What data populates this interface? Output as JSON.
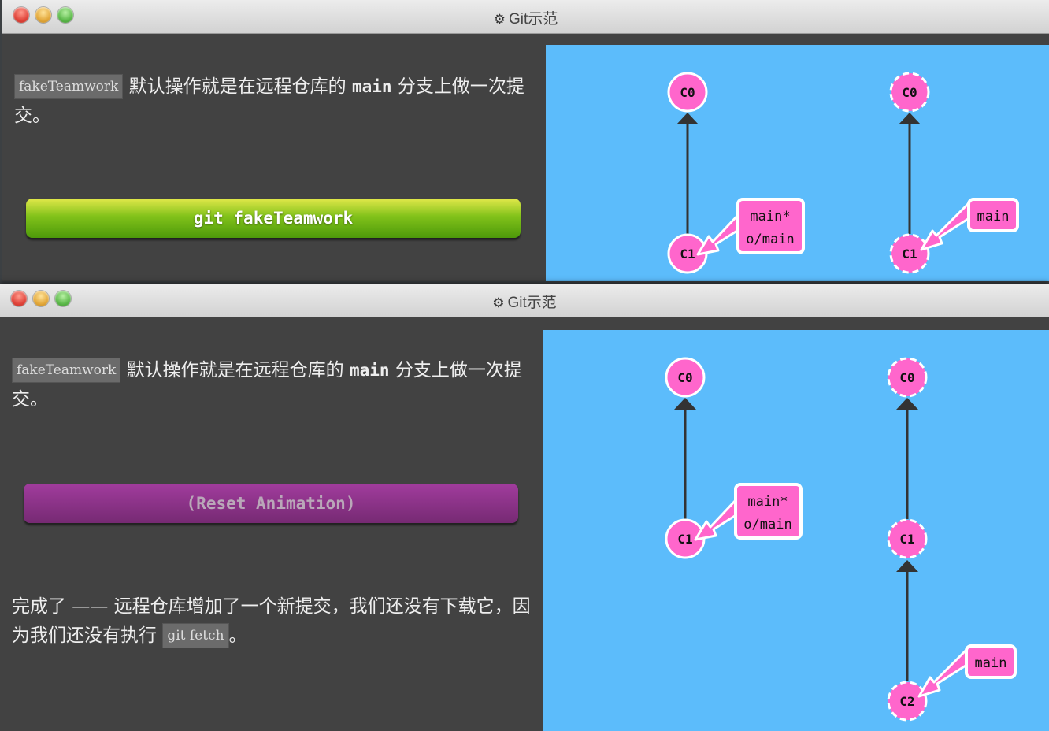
{
  "window1": {
    "title": "Git示范",
    "desc": {
      "cmd": "fakeTeamwork",
      "part1": "默认操作就是在远程仓库的",
      "branch": "main",
      "part2": "分支上做一次提交。"
    },
    "button_label": "git fakeTeamwork",
    "local_tree": {
      "commits": [
        "C0",
        "C1"
      ],
      "branch_lines": [
        "main*",
        "o/main"
      ]
    },
    "remote_tree": {
      "commits": [
        "C0",
        "C1"
      ],
      "branch": "main"
    }
  },
  "window2": {
    "title": "Git示范",
    "desc": {
      "cmd": "fakeTeamwork",
      "part1": "默认操作就是在远程仓库的",
      "branch": "main",
      "part2": "分支上做一次提交。"
    },
    "button_label": "(Reset Animation)",
    "note": {
      "part1": "完成了 —— 远程仓库增加了一个新提交，我们还没有下载它，因为我们还没有执行",
      "cmd": "git fetch",
      "part2": "。"
    },
    "local_tree": {
      "commits": [
        "C0",
        "C1"
      ],
      "branch_lines": [
        "main*",
        "o/main"
      ]
    },
    "remote_tree": {
      "commits": [
        "C0",
        "C1",
        "C2"
      ],
      "branch": "main"
    }
  },
  "colors": {
    "canvas": "#5cbcfb",
    "commit": "#ff66cc",
    "panel": "#424242",
    "button_green": "#82c21a",
    "button_purple": "#762a73"
  },
  "icons": [
    "gear-icon",
    "close-light-icon",
    "minimize-light-icon",
    "zoom-light-icon"
  ]
}
